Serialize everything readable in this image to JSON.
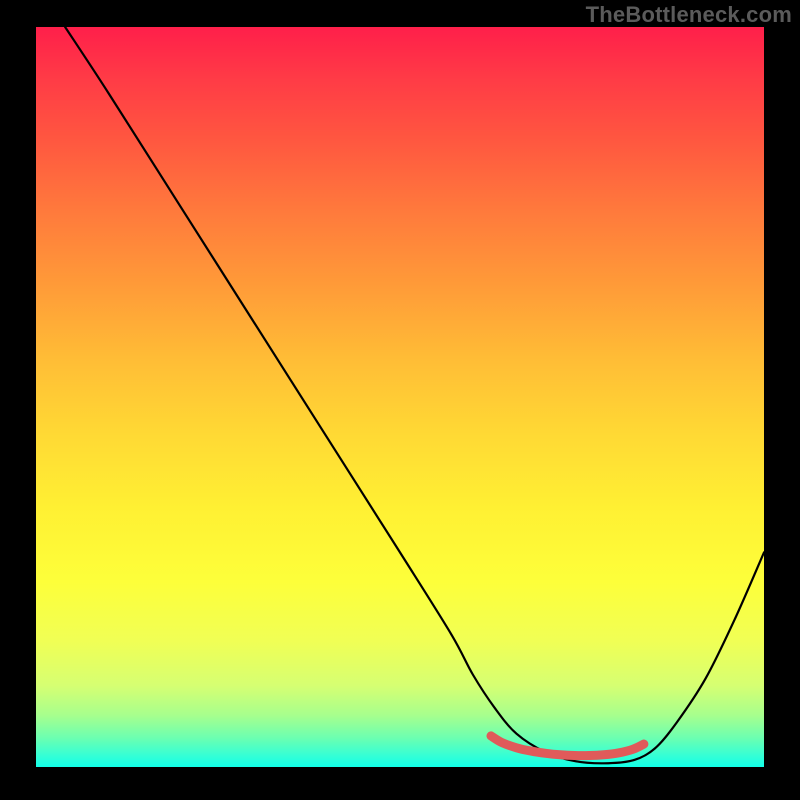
{
  "watermark": "TheBottleneck.com",
  "chart_data": {
    "type": "line",
    "title": "",
    "xlabel": "",
    "ylabel": "",
    "xlim": [
      0,
      100
    ],
    "ylim": [
      0,
      100
    ],
    "grid": false,
    "legend": false,
    "series": [
      {
        "name": "black-curve",
        "color": "#000000",
        "x": [
          4,
          10,
          20,
          30,
          40,
          50,
          57,
          60,
          63,
          66,
          70,
          74,
          78,
          82,
          85,
          88,
          92,
          96,
          100
        ],
        "y": [
          100,
          91,
          75.5,
          60,
          44.5,
          29,
          18,
          12.5,
          8,
          4.5,
          2,
          0.8,
          0.5,
          0.9,
          2.5,
          6,
          12,
          20,
          29
        ]
      },
      {
        "name": "red-marker-band",
        "color": "#e05a5a",
        "x": [
          62.5,
          64,
          66,
          68,
          70,
          72,
          74,
          76,
          78,
          80,
          82,
          83.5
        ],
        "y": [
          4.2,
          3.3,
          2.6,
          2.15,
          1.85,
          1.65,
          1.55,
          1.55,
          1.65,
          1.9,
          2.4,
          3.1
        ]
      }
    ],
    "gradient_stops": [
      {
        "pos": 0.0,
        "color": "#ff1f4a"
      },
      {
        "pos": 0.07,
        "color": "#ff3b46"
      },
      {
        "pos": 0.15,
        "color": "#ff5640"
      },
      {
        "pos": 0.25,
        "color": "#ff7a3c"
      },
      {
        "pos": 0.35,
        "color": "#ff9b38"
      },
      {
        "pos": 0.45,
        "color": "#ffbd36"
      },
      {
        "pos": 0.55,
        "color": "#ffd934"
      },
      {
        "pos": 0.65,
        "color": "#fff033"
      },
      {
        "pos": 0.75,
        "color": "#fdff3a"
      },
      {
        "pos": 0.83,
        "color": "#f0ff55"
      },
      {
        "pos": 0.89,
        "color": "#d6ff72"
      },
      {
        "pos": 0.93,
        "color": "#a7ff8d"
      },
      {
        "pos": 0.96,
        "color": "#6dffb0"
      },
      {
        "pos": 0.985,
        "color": "#34ffd6"
      },
      {
        "pos": 1.0,
        "color": "#12ffe8"
      }
    ]
  }
}
